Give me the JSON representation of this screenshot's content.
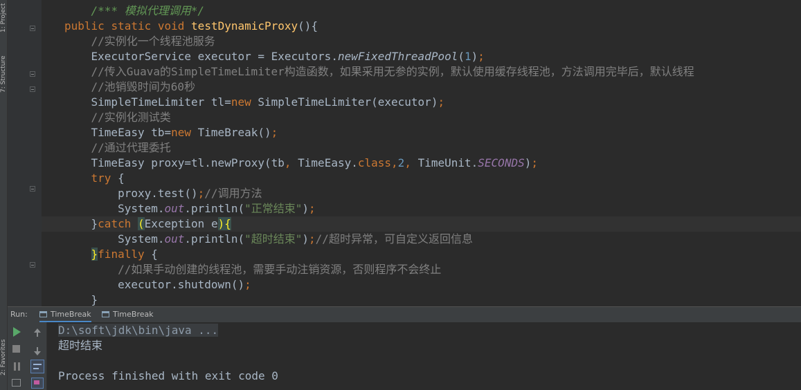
{
  "left_strip": {
    "top_tab_label": "1: Project",
    "structure_tab_label": "7: Structure",
    "favorites_tab_label": "2: Favorites"
  },
  "editor": {
    "lines": [
      {
        "parts": [
          {
            "t": "    ",
            "c": ""
          },
          {
            "t": "/*** 模拟代理调用*/",
            "c": "doc"
          }
        ]
      },
      {
        "parts": [
          {
            "t": "public ",
            "c": "kw"
          },
          {
            "t": "static ",
            "c": "kw"
          },
          {
            "t": "void ",
            "c": "kw"
          },
          {
            "t": "testDynamicProxy",
            "c": "fn"
          },
          {
            "t": "(){",
            "c": ""
          }
        ]
      },
      {
        "parts": [
          {
            "t": "    ",
            "c": ""
          },
          {
            "t": "//实例化一个线程池服务",
            "c": "cmt"
          }
        ]
      },
      {
        "parts": [
          {
            "t": "    ExecutorService executor = Executors.",
            "c": ""
          },
          {
            "t": "newFixedThreadPool",
            "c": "ital"
          },
          {
            "t": "(",
            "c": ""
          },
          {
            "t": "1",
            "c": "num"
          },
          {
            "t": ")",
            "c": ""
          },
          {
            "t": ";",
            "c": "kw"
          }
        ]
      },
      {
        "parts": [
          {
            "t": "    ",
            "c": ""
          },
          {
            "t": "//传入Guava的SimpleTimeLimiter构造函数，如果采用无参的实例，默认使用缓存线程池，方法调用完毕后，默认线程",
            "c": "cmt"
          }
        ]
      },
      {
        "parts": [
          {
            "t": "    ",
            "c": ""
          },
          {
            "t": "//池销毁时间为60秒",
            "c": "cmt"
          }
        ]
      },
      {
        "parts": [
          {
            "t": "    SimpleTimeLimiter tl=",
            "c": ""
          },
          {
            "t": "new ",
            "c": "kw"
          },
          {
            "t": "SimpleTimeLimiter(executor)",
            "c": ""
          },
          {
            "t": ";",
            "c": "kw"
          }
        ]
      },
      {
        "parts": [
          {
            "t": "    ",
            "c": ""
          },
          {
            "t": "//实例化测试类",
            "c": "cmt"
          }
        ]
      },
      {
        "parts": [
          {
            "t": "    TimeEasy tb=",
            "c": ""
          },
          {
            "t": "new ",
            "c": "kw"
          },
          {
            "t": "TimeBreak()",
            "c": ""
          },
          {
            "t": ";",
            "c": "kw"
          }
        ]
      },
      {
        "parts": [
          {
            "t": "    ",
            "c": ""
          },
          {
            "t": "//通过代理委托",
            "c": "cmt"
          }
        ]
      },
      {
        "parts": [
          {
            "t": "    TimeEasy proxy=tl.newProxy(tb",
            "c": ""
          },
          {
            "t": ", ",
            "c": "kw"
          },
          {
            "t": "TimeEasy.",
            "c": ""
          },
          {
            "t": "class",
            "c": "kw"
          },
          {
            "t": ",",
            "c": "kw"
          },
          {
            "t": "2",
            "c": "num"
          },
          {
            "t": ", ",
            "c": "kw"
          },
          {
            "t": "TimeUnit.",
            "c": ""
          },
          {
            "t": "SECONDS",
            "c": "static-field"
          },
          {
            "t": ")",
            "c": ""
          },
          {
            "t": ";",
            "c": "kw"
          }
        ]
      },
      {
        "parts": [
          {
            "t": "    ",
            "c": ""
          },
          {
            "t": "try ",
            "c": "kw"
          },
          {
            "t": "{",
            "c": ""
          }
        ]
      },
      {
        "parts": [
          {
            "t": "        proxy.test()",
            "c": ""
          },
          {
            "t": ";",
            "c": "kw"
          },
          {
            "t": "//调用方法",
            "c": "cmt"
          }
        ]
      },
      {
        "parts": [
          {
            "t": "        System.",
            "c": ""
          },
          {
            "t": "out",
            "c": "static-field"
          },
          {
            "t": ".println(",
            "c": ""
          },
          {
            "t": "\"正常结束\"",
            "c": "str"
          },
          {
            "t": ")",
            "c": ""
          },
          {
            "t": ";",
            "c": "kw"
          }
        ]
      },
      {
        "parts": [
          {
            "t": "    }",
            "c": ""
          },
          {
            "t": "catch ",
            "c": "kw"
          },
          {
            "t": "(",
            "c": "brace-match"
          },
          {
            "t": "Exception e",
            "c": ""
          },
          {
            "t": ")",
            "c": "brace-match"
          },
          {
            "t": "{",
            "c": "brace-match"
          }
        ]
      },
      {
        "parts": [
          {
            "t": "        System.",
            "c": ""
          },
          {
            "t": "out",
            "c": "static-field"
          },
          {
            "t": ".println(",
            "c": ""
          },
          {
            "t": "\"超时结束\"",
            "c": "str"
          },
          {
            "t": ")",
            "c": ""
          },
          {
            "t": ";",
            "c": "kw"
          },
          {
            "t": "//超时异常，可自定义返回信息",
            "c": "cmt"
          }
        ]
      },
      {
        "parts": [
          {
            "t": "    ",
            "c": ""
          },
          {
            "t": "}",
            "c": "brace-match"
          },
          {
            "t": "finally ",
            "c": "kw"
          },
          {
            "t": "{",
            "c": ""
          }
        ]
      },
      {
        "parts": [
          {
            "t": "        ",
            "c": ""
          },
          {
            "t": "//如果手动创建的线程池，需要手动注销资源，否则程序不会终止",
            "c": "cmt"
          }
        ]
      },
      {
        "parts": [
          {
            "t": "        executor.shutdown()",
            "c": ""
          },
          {
            "t": ";",
            "c": "kw"
          }
        ]
      },
      {
        "parts": [
          {
            "t": "    }",
            "c": ""
          }
        ]
      }
    ],
    "current_line_index": 14
  },
  "run_bar": {
    "label": "Run:",
    "tabs": [
      {
        "label": "TimeBreak",
        "active": true
      },
      {
        "label": "TimeBreak",
        "active": false
      }
    ]
  },
  "console": {
    "lines": [
      {
        "text": "D:\\soft\\jdk\\bin\\java ...",
        "kind": "cmd"
      },
      {
        "text": "超时结束",
        "kind": "out"
      },
      {
        "text": "",
        "kind": "out"
      },
      {
        "text": "Process finished with exit code 0",
        "kind": "out"
      }
    ]
  },
  "icons": {
    "rerun": "play-icon",
    "stop": "stop-icon",
    "pause": "pause-icon",
    "dump": "camera-icon",
    "up": "arrow-up-icon",
    "down": "arrow-down-icon",
    "soft_wrap": "soft-wrap-icon",
    "print": "print-icon"
  },
  "colors": {
    "background": "#2b2b2b",
    "keyword": "#cc7832",
    "method": "#ffc66d",
    "comment": "#808080",
    "string": "#6a8759",
    "number": "#6897bb",
    "field": "#9876aa",
    "run_green": "#59a869"
  }
}
